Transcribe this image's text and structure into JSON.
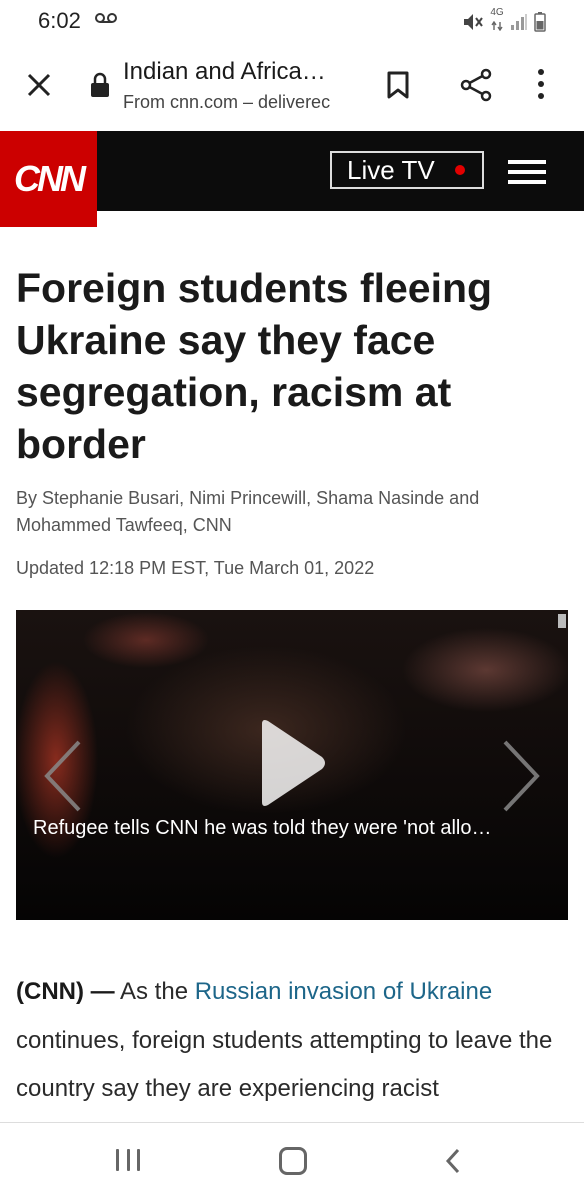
{
  "status_bar": {
    "time": "6:02",
    "network": "4G",
    "icons": [
      "voicemail-icon",
      "mute-icon",
      "network-arrows-icon",
      "signal-icon",
      "battery-icon"
    ]
  },
  "browser": {
    "title": "Indian and Africa…",
    "source": "From cnn.com – deliverec",
    "icons": [
      "close-icon",
      "lock-icon",
      "bookmark-icon",
      "share-icon",
      "more-vertical-icon"
    ]
  },
  "header": {
    "logo": "CNN",
    "live_tv": "Live TV",
    "colors": {
      "logo_bg": "#cc0000",
      "bar_bg": "#0c0c0c",
      "live_dot": "#e30000"
    }
  },
  "article": {
    "headline": "Foreign students fleeing Ukraine say they face segregation, racism at border",
    "byline": "By Stephanie Busari, Nimi Princewill, Shama Nasinde and Mohammed Tawfeeq, CNN",
    "updated": "Updated 12:18 PM EST, Tue March 01, 2022",
    "video_caption": "Refugee tells CNN he was told they were 'not allo…",
    "body_lead": "(CNN) —",
    "body_text_1": " As the ",
    "body_link": "Russian invasion of Ukraine",
    "body_text_2": " continues, foreign students attempting to leave the country say they are experiencing racist",
    "link_color": "#1d6689"
  },
  "nav_bar": {
    "icons": [
      "recents-icon",
      "home-icon",
      "back-icon"
    ]
  }
}
